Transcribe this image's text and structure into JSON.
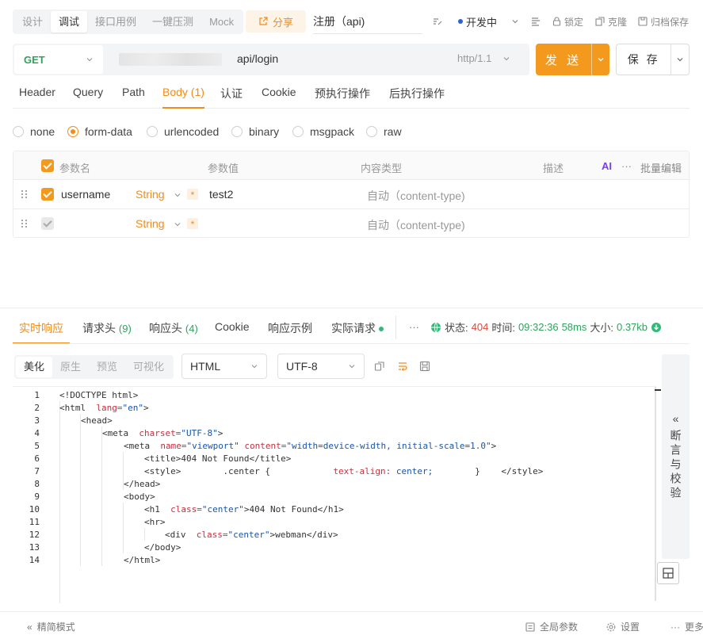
{
  "mode_tabs": [
    {
      "label": "设计",
      "active": false
    },
    {
      "label": "调试",
      "active": true
    },
    {
      "label": "接口用例",
      "active": false
    },
    {
      "label": "一键压测",
      "active": false
    },
    {
      "label": "Mock",
      "active": false
    }
  ],
  "share_label": "分享",
  "api_name": "注册（api)",
  "toolbar": {
    "status_label": "开发中",
    "lock_label": "锁定",
    "clone_label": "克隆",
    "archive_label": "归档保存"
  },
  "request": {
    "method": "GET",
    "path": "api/login",
    "protocol": "http/1.1",
    "send_label": "发 送",
    "save_label": "保 存"
  },
  "request_tabs": [
    {
      "label": "Header",
      "active": false
    },
    {
      "label": "Query",
      "active": false
    },
    {
      "label": "Path",
      "active": false
    },
    {
      "label": "Body (1)",
      "active": true
    },
    {
      "label": "认证",
      "active": false
    },
    {
      "label": "Cookie",
      "active": false
    },
    {
      "label": "预执行操作",
      "active": false
    },
    {
      "label": "后执行操作",
      "active": false
    }
  ],
  "body_types": [
    {
      "label": "none",
      "selected": false
    },
    {
      "label": "form-data",
      "selected": true
    },
    {
      "label": "urlencoded",
      "selected": false
    },
    {
      "label": "binary",
      "selected": false
    },
    {
      "label": "msgpack",
      "selected": false
    },
    {
      "label": "raw",
      "selected": false
    }
  ],
  "param_table": {
    "headers": {
      "name": "参数名",
      "value": "参数值",
      "content_type": "内容类型",
      "desc": "描述",
      "ai": "AI",
      "more": "···",
      "bulk_edit": "批量编辑"
    },
    "rows": [
      {
        "name": "username",
        "type": "String",
        "required": "*",
        "value": "test2",
        "content_type": "自动（content-type)"
      },
      {
        "name": "",
        "type": "String",
        "required": "*",
        "value": "",
        "content_type": "自动（content-type)"
      }
    ]
  },
  "response_tabs": {
    "realtime": "实时响应",
    "req_headers": "请求头",
    "req_headers_count": "(9)",
    "resp_headers": "响应头",
    "resp_headers_count": "(4)",
    "cookie": "Cookie",
    "example": "响应示例",
    "actual": "实际请求",
    "more": "···"
  },
  "status": {
    "status_label": "状态:",
    "status_code": "404",
    "time_label": "时间:",
    "time_value": "09:32:36",
    "duration": "58ms",
    "size_label": "大小:",
    "size_value": "0.37kb"
  },
  "view_tabs": [
    {
      "label": "美化",
      "active": true
    },
    {
      "label": "原生",
      "active": false
    },
    {
      "label": "预览",
      "active": false
    },
    {
      "label": "可视化",
      "active": false
    }
  ],
  "format_select": "HTML",
  "encoding_select": "UTF-8",
  "code_lines": [
    "1",
    "2",
    "3",
    "4",
    "5",
    "6",
    "7",
    "8",
    "9",
    "10",
    "11",
    "12",
    "13",
    "14"
  ],
  "code": {
    "l1": "<!DOCTYPE html>",
    "l2_tag": "<html",
    "l2_attr": "lang=",
    "l2_val": "\"en\"",
    "l2_end": ">",
    "l3": "<head>",
    "l4_tag": "<meta",
    "l4_attr": "charset=",
    "l4_val": "\"UTF-8\"",
    "l4_end": ">",
    "l5_tag": "<meta",
    "l5_attr1": "name=",
    "l5_val1": "\"viewport\"",
    "l5_attr2": "content=",
    "l5_val2": "\"width=device-width, initial-scale=1.0\"",
    "l5_end": ">",
    "l6": "<title>404 Not Found</title>",
    "l7_a": "<style>        .center {",
    "l7_prop": "text-align:",
    "l7_val": "center;",
    "l7_b": "}    </style>",
    "l8": "</head>",
    "l9": "<body>",
    "l10_tag": "<h1",
    "l10_attr": "class=",
    "l10_val": "\"center\"",
    "l10_end": ">404 Not Found</h1>",
    "l11": "<hr>",
    "l12_tag": "<div",
    "l12_attr": "class=",
    "l12_val": "\"center\"",
    "l12_end": ">webman</div>",
    "l13": "</body>",
    "l14": "</html>"
  },
  "assert_panel": {
    "chevron": "«",
    "label": "断言与校验"
  },
  "footer": {
    "simple_mode": "精简模式",
    "global_params": "全局参数",
    "settings": "设置",
    "more": "更多"
  },
  "colors": {
    "accent": "#f39a1e",
    "method_get": "#2fa35c",
    "status_error": "#e04a3a"
  }
}
